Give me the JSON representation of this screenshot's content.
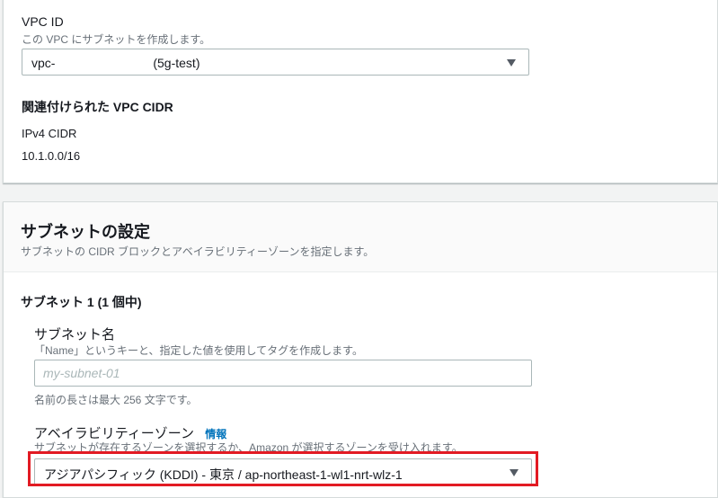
{
  "vpc_section": {
    "vpc_id_label": "VPC ID",
    "vpc_id_desc": "この VPC にサブネットを作成します。",
    "vpc_select_value": "vpc-                            (5g-test)",
    "cidr_heading": "関連付けられた VPC CIDR",
    "ipv4_label": "IPv4 CIDR",
    "ipv4_value": "10.1.0.0/16"
  },
  "subnet_settings": {
    "title": "サブネットの設定",
    "desc": "サブネットの CIDR ブロックとアベイラビリティーゾーンを指定します。",
    "subnet_count": "サブネット 1 (1 個中)",
    "name_label": "サブネット名",
    "name_desc": "「Name」というキーと、指定した値を使用してタグを作成します。",
    "name_placeholder": "my-subnet-01",
    "name_hint": "名前の長さは最大 256 文字です。",
    "az_label": "アベイラビリティーゾーン",
    "az_info": "情報",
    "az_desc": "サブネットが存在するゾーンを選択するか、Amazon が選択するゾーンを受け入れます。",
    "az_select_value": "アジアパシフィック (KDDI) - 東京 / ap-northeast-1-wl1-nrt-wlz-1"
  },
  "icons": {
    "caret": "caret-down-icon"
  },
  "colors": {
    "highlight": "#e21b23",
    "link": "#0073bb"
  }
}
